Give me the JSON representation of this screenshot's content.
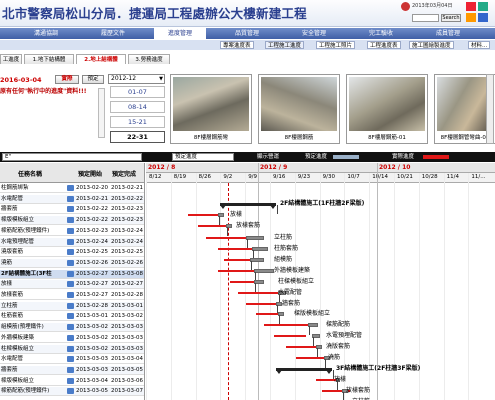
{
  "banner": {
    "title": "北市警察局松山分局．捷運局工程處辦公大樓新建工程",
    "date": "2013年03月04日",
    "search_placeholder": "",
    "search_label": "Search"
  },
  "nav": {
    "items": [
      "溝通協調",
      "履歷文件",
      "進度管理",
      "品質管理",
      "安全管理",
      "完工驗收",
      "成員管理"
    ],
    "active": 2
  },
  "subnav": {
    "items": [
      "專案進度表",
      "工程施工進度",
      "工程施工照片",
      "工程進度表",
      "施工圖繪製進度",
      "材料..."
    ],
    "active": 1
  },
  "page_tabs": [
    "工進度",
    "1.地下結構體",
    "2.地上結構體",
    "3.勞務進度"
  ],
  "page_tab_active": 2,
  "control": {
    "date": "2016-03-04",
    "actual_label": "實際",
    "plan_label": "預定",
    "month_select": "2012-12"
  },
  "note": "原有任何\"執行中的進度\"資料!!!",
  "date_list": [
    "01-07",
    "08-14",
    "15-21",
    "22-31"
  ],
  "date_selected": 3,
  "photos": [
    {
      "caption": "8F樓層鋼筋彎"
    },
    {
      "caption": "8F樓層鋼筋"
    },
    {
      "caption": "8F樓層鋼筋-01"
    },
    {
      "caption": "8F樓層鋼管彎曲-02"
    }
  ],
  "toolbar": {
    "sel_left": "E\"",
    "view_select": "預定進度",
    "show_label": "顯示營運",
    "plan_label": "預定進度",
    "actual_label": "實際進度"
  },
  "grid": {
    "headers": {
      "name": "任務名稱",
      "start": "預定開始",
      "end": "預定完成"
    },
    "rows": [
      {
        "name": "柱鋼筋綁紮",
        "start": "2013-02-20",
        "end": "2013-02-21",
        "hl": false,
        "bold": false
      },
      {
        "name": "水電配管",
        "start": "2013-02-21",
        "end": "2013-02-22",
        "hl": false,
        "bold": false
      },
      {
        "name": "牆套筋",
        "start": "2013-02-22",
        "end": "2013-02-23",
        "hl": false,
        "bold": false
      },
      {
        "name": "樑版模板組立",
        "start": "2013-02-22",
        "end": "2013-02-23",
        "hl": false,
        "bold": false
      },
      {
        "name": "樑筋配筋(預埋鐵件)",
        "start": "2013-02-23",
        "end": "2013-02-24",
        "hl": false,
        "bold": false
      },
      {
        "name": "水電預埋配管",
        "start": "2013-02-24",
        "end": "2013-02-24",
        "hl": false,
        "bold": false
      },
      {
        "name": "澆版套筋",
        "start": "2013-02-25",
        "end": "2013-02-25",
        "hl": false,
        "bold": false
      },
      {
        "name": "澆筋",
        "start": "2013-02-26",
        "end": "2013-02-26",
        "hl": false,
        "bold": false
      },
      {
        "name": "2F結構體施工(3F柱",
        "start": "2013-02-27",
        "end": "2013-03-08",
        "hl": true,
        "bold": true
      },
      {
        "name": "放樣",
        "start": "2013-02-27",
        "end": "2013-02-27",
        "hl": false,
        "bold": false
      },
      {
        "name": "放樣套筋",
        "start": "2013-02-27",
        "end": "2013-02-28",
        "hl": false,
        "bold": false
      },
      {
        "name": "立柱筋",
        "start": "2013-02-28",
        "end": "2013-03-01",
        "hl": false,
        "bold": false
      },
      {
        "name": "柱筋套筋",
        "start": "2013-03-01",
        "end": "2013-03-02",
        "hl": false,
        "bold": false
      },
      {
        "name": "組模筋(預埋鐵件)",
        "start": "2013-03-02",
        "end": "2013-03-03",
        "hl": false,
        "bold": false
      },
      {
        "name": "外牆模板建築",
        "start": "2013-03-02",
        "end": "2013-03-03",
        "hl": false,
        "bold": false
      },
      {
        "name": "柱樑模板組立",
        "start": "2013-03-02",
        "end": "2013-03-03",
        "hl": false,
        "bold": false
      },
      {
        "name": "水電配管",
        "start": "2013-03-03",
        "end": "2013-03-04",
        "hl": false,
        "bold": false
      },
      {
        "name": "牆套筋",
        "start": "2013-03-03",
        "end": "2013-03-05",
        "hl": false,
        "bold": false
      },
      {
        "name": "樑版模板組立",
        "start": "2013-03-04",
        "end": "2013-03-06",
        "hl": false,
        "bold": false
      },
      {
        "name": "樑筋配筋(預埋鐵件)",
        "start": "2013-03-05",
        "end": "2013-03-07",
        "hl": false,
        "bold": false
      }
    ]
  },
  "gantt": {
    "months": [
      "2012 / 8",
      "2012 / 9",
      "2012 / 10"
    ],
    "weeks": [
      "8/12",
      "8/19",
      "8/26",
      "9/2",
      "9/9",
      "9/16",
      "9/23",
      "9/30",
      "10/7",
      "10/14",
      "10/21",
      "10/28",
      "11/4",
      "11/..."
    ],
    "labels": [
      {
        "text": "2F結構體施工(1F柱牆2F梁版)",
        "bold": true
      },
      {
        "text": "放樣",
        "bold": false
      },
      {
        "text": "放樣套筋",
        "bold": false
      },
      {
        "text": "立柱筋",
        "bold": false
      },
      {
        "text": "柱筋套筋",
        "bold": false
      },
      {
        "text": "組模筋",
        "bold": false
      },
      {
        "text": "外牆模板建築",
        "bold": false
      },
      {
        "text": "柱樑模板組立",
        "bold": false
      },
      {
        "text": "水電配管",
        "bold": false
      },
      {
        "text": "牆套筋",
        "bold": false
      },
      {
        "text": "樑版模板組立",
        "bold": false
      },
      {
        "text": "樑筋配筋",
        "bold": false
      },
      {
        "text": "水電預埋配管",
        "bold": false
      },
      {
        "text": "澆版套筋",
        "bold": false
      },
      {
        "text": "澆筋",
        "bold": false
      },
      {
        "text": "3F結構體施工(2F柱牆3F梁版)",
        "bold": true
      },
      {
        "text": "放樣",
        "bold": false
      },
      {
        "text": "放樣套筋",
        "bold": false
      },
      {
        "text": "立柱筋",
        "bold": false
      }
    ]
  },
  "colors": {
    "nav": "#3f5fa6",
    "plan": "#8a8a8a",
    "actual": "#e01818",
    "title": "#2a3f8f"
  }
}
